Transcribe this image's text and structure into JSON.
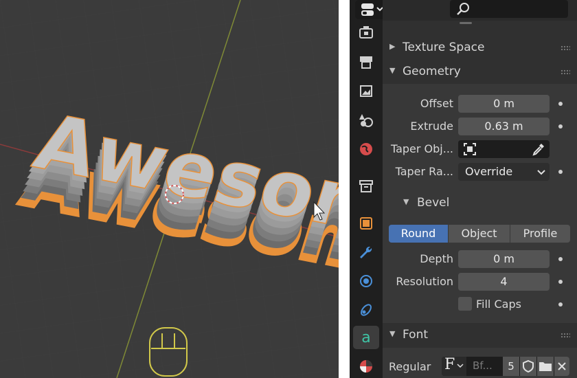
{
  "viewport": {
    "word": "Awesome"
  },
  "properties": {
    "panels": {
      "texture_space": "Texture Space",
      "geometry": "Geometry",
      "bevel": "Bevel",
      "font": "Font"
    },
    "geometry": {
      "offset_label": "Offset",
      "offset_value": "0 m",
      "extrude_label": "Extrude",
      "extrude_value": "0.63 m",
      "taper_object_label": "Taper Obj...",
      "taper_radius_label": "Taper Ra...",
      "taper_radius_value": "Override"
    },
    "bevel": {
      "modes": [
        "Round",
        "Object",
        "Profile"
      ],
      "selected_mode": "Round",
      "depth_label": "Depth",
      "depth_value": "0 m",
      "resolution_label": "Resolution",
      "resolution_value": "4",
      "fill_caps_label": "Fill Caps",
      "fill_caps_checked": false
    },
    "font": {
      "regular_label": "Regular",
      "font_name": "Bf...",
      "users_count": "5"
    },
    "colors": {
      "accent_blue": "#4772b3",
      "selection_orange": "#e8913a",
      "panel_bg": "#303030",
      "field_bg": "#545454"
    }
  }
}
